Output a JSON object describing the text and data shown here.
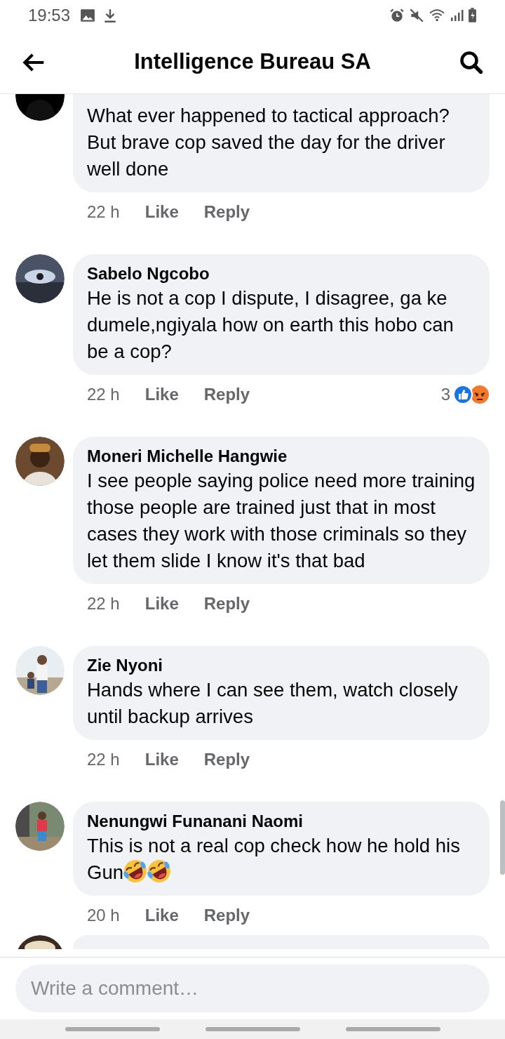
{
  "status_bar": {
    "time": "19:53"
  },
  "header": {
    "title": "Intelligence Bureau SA"
  },
  "comments": [
    {
      "kind": "cut",
      "text": "What ever happened to tactical approach? But brave cop saved the day for the driver well done",
      "time": "22 h",
      "like": "Like",
      "reply": "Reply"
    },
    {
      "kind": "full",
      "name": "Sabelo Ngcobo",
      "text": "He is not a cop I dispute, I disagree, ga ke dumele,ngiyala how on earth this hobo can be a cop?",
      "time": "22 h",
      "like": "Like",
      "reply": "Reply",
      "reactions": {
        "count": "3",
        "icons": [
          {
            "kind": "like"
          },
          {
            "kind": "angry"
          }
        ]
      }
    },
    {
      "kind": "full",
      "name": "Moneri Michelle Hangwie",
      "text": "I see people saying police need more training those people are trained just that in most cases they work with those criminals so they let them slide I know it's that bad",
      "time": "22 h",
      "like": "Like",
      "reply": "Reply"
    },
    {
      "kind": "full",
      "name": "Zie Nyoni",
      "text": "Hands where I can see them, watch closely until backup arrives",
      "time": "22 h",
      "like": "Like",
      "reply": "Reply"
    },
    {
      "kind": "full",
      "name": "Nenungwi Funanani Naomi",
      "text": "This is not a real cop check how he hold his Gun",
      "emojis": [
        {
          "kind": "rofl"
        },
        {
          "kind": "rofl"
        }
      ],
      "time": "20 h",
      "like": "Like",
      "reply": "Reply"
    },
    {
      "kind": "peek"
    }
  ],
  "composer": {
    "placeholder": "Write a comment…"
  }
}
